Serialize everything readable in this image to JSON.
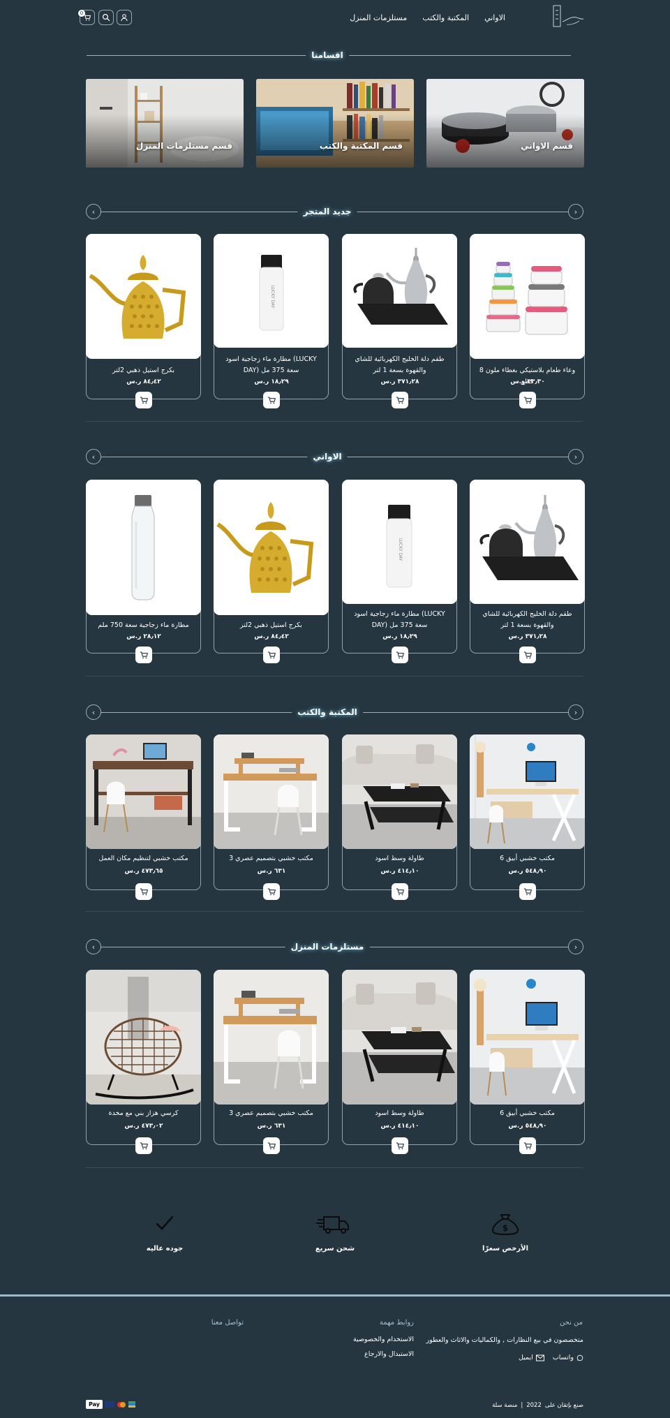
{
  "header": {
    "nav": [
      "الاواني",
      "المكتبة والكتب",
      "مستلزمات المنزل"
    ],
    "cart_count": "0"
  },
  "sections": {
    "categories_title": "اقسامنا",
    "new_title": "جديد المتجر",
    "pots_title": "الاواني",
    "library_title": "المكتبة والكتب",
    "home_title": "مستلزمات المنزل"
  },
  "categories": [
    "قسم الاواني",
    "قسم المكتبة والكتب",
    "قسم مستلزمات المنزل"
  ],
  "new_products": [
    {
      "name": "وعاء طعام بلاستيكي بغطاء ملون 8 قطع",
      "price": "٣٣٫٣٠ ر.س"
    },
    {
      "name": "طقم دلة الخليج الكهربائية للشاي والقهوة بسعة 1 لتر",
      "price": "٣٧١٫٢٨ ر.س"
    },
    {
      "name": "مطارة ماء زجاجية اسود (LUCKY DAY) سعة 375 مل",
      "price": "١٨٫٢٩ ر.س"
    },
    {
      "name": "بكرج استيل ذهبي 2لتر",
      "price": "٨٤٫٤٢ ر.س"
    }
  ],
  "pots_products": [
    {
      "name": "طقم دلة الخليج الكهربائية للشاي والقهوة بسعة 1 لتر",
      "price": "٣٧١٫٢٨ ر.س"
    },
    {
      "name": "مطارة ماء زجاجية اسود (LUCKY DAY) سعة 375 مل",
      "price": "١٨٫٢٩ ر.س"
    },
    {
      "name": "بكرج استيل ذهبي 2لتر",
      "price": "٨٤٫٤٢ ر.س"
    },
    {
      "name": "مطارة ماء زجاجية سعة 750 ملم",
      "price": "٢٨٫١٢ ر.س"
    }
  ],
  "library_products": [
    {
      "name": "مكتب خشبي أبيق 6",
      "price": "٥٤٨٫٩٠ ر.س"
    },
    {
      "name": "طاولة وسط اسود",
      "price": "٤١٤٫١٠ ر.س"
    },
    {
      "name": "مكتب خشبي بتصميم عصري 3",
      "price": "٦٣١ ر.س"
    },
    {
      "name": "مكتب خشبي لتنظيم مكان العمل",
      "price": "٤٧٣٫٦٥ ر.س"
    }
  ],
  "home_products": [
    {
      "name": "مكتب خشبي أبيق 6",
      "price": "٥٤٨٫٩٠ ر.س"
    },
    {
      "name": "طاولة وسط اسود",
      "price": "٤١٤٫١٠ ر.س"
    },
    {
      "name": "مكتب خشبي بتصميم عصري 3",
      "price": "٦٣١ ر.س"
    },
    {
      "name": "كرسي هزاز بني مع مخدة",
      "price": "٤٧٣٫٠٢ ر.س"
    }
  ],
  "features": [
    "الأرخص سعرًا",
    "شحن سريع",
    "جوده عاليه"
  ],
  "footer": {
    "about_title": "من نحن",
    "about_text": "متخصصون في بيع النظارات , والكماليات والاثاث والعطور",
    "whatsapp": "واتساب",
    "email": "ايميل",
    "links_title": "روابط مهمة",
    "links": [
      "الاستخدام والخصوصية",
      "الاستبدال والارجاع"
    ],
    "contact_title": "تواصل معنا",
    "copyright": "صنع بإتقان على",
    "year": "2022",
    "platform": "منصة سلة",
    "pay_label": "Pay"
  },
  "colors": {
    "background": "#253640",
    "accent": "#7fd0f2",
    "border": "#95a2ab"
  }
}
